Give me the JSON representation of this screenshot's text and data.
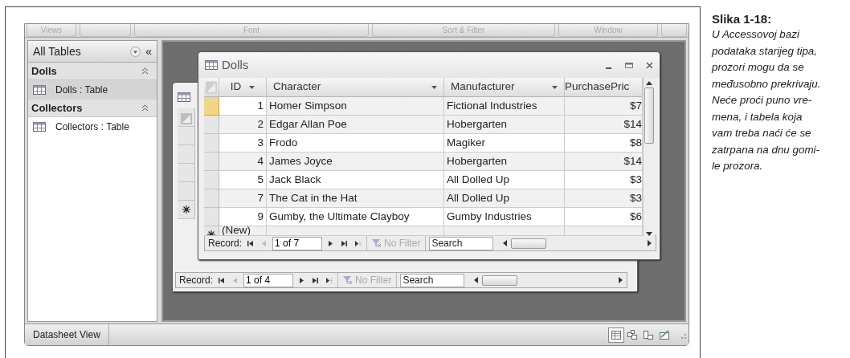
{
  "ribbon": {
    "groups": [
      {
        "label": "Views"
      },
      {
        "label": "Font"
      },
      {
        "label": "Sort & Filter"
      },
      {
        "label": "Window"
      }
    ]
  },
  "navigation_pane": {
    "title": "All Tables",
    "collapse": "«",
    "groups": [
      {
        "label": "Dolls",
        "items": [
          {
            "label": "Dolls : Table",
            "selected": true
          }
        ]
      },
      {
        "label": "Collectors",
        "items": [
          {
            "label": "Collectors : Table",
            "selected": false
          }
        ]
      }
    ]
  },
  "back_window": {
    "record_nav": {
      "label": "Record:",
      "position": "1 of 4",
      "filter": {
        "label": "No Filter",
        "disabled": true
      },
      "search_placeholder": "Search"
    }
  },
  "front_window": {
    "title": "Dolls",
    "columns": [
      {
        "label": "ID",
        "menu": true
      },
      {
        "label": "Character",
        "menu": true
      },
      {
        "label": "Manufacturer",
        "menu": true
      },
      {
        "label": "PurchasePric",
        "menu": false
      }
    ],
    "rows": [
      {
        "cells": [
          "1",
          "Homer Simpson",
          "Fictional Industries",
          "$7"
        ],
        "selected": true
      },
      {
        "cells": [
          "2",
          "Edgar Allan Poe",
          "Hobergarten",
          "$14"
        ],
        "selected": false
      },
      {
        "cells": [
          "3",
          "Frodo",
          "Magiker",
          "$8"
        ],
        "selected": false
      },
      {
        "cells": [
          "4",
          "James Joyce",
          "Hobergarten",
          "$14"
        ],
        "selected": false
      },
      {
        "cells": [
          "5",
          "Jack Black",
          "All Dolled Up",
          "$3"
        ],
        "selected": false
      },
      {
        "cells": [
          "7",
          "The Cat in the Hat",
          "All Dolled Up",
          "$3"
        ],
        "selected": false
      },
      {
        "cells": [
          "9",
          "Gumby, the Ultimate Clayboy",
          "Gumby Industries",
          "$6"
        ],
        "selected": false
      }
    ],
    "new_row": "(New)",
    "record_nav": {
      "label": "Record:",
      "position": "1 of 7",
      "filter": {
        "label": "No Filter",
        "disabled": true
      },
      "search_placeholder": "Search"
    }
  },
  "status_bar": {
    "text": "Datasheet View",
    "view_buttons": [
      {
        "selected": true
      },
      {
        "selected": false
      },
      {
        "selected": false
      },
      {
        "selected": false
      }
    ]
  },
  "caption": {
    "label": "Slika 1-18:",
    "text": "U Accessovoj bazi\npodataka starijeg tipa,\nprozori mogu da se\nmeđusobno prekrivaju.\nNeće proći puno vre-\nmena, i tabela koja\nvam treba naći će se\nzatrpana na dnu gomi-\nle prozora."
  }
}
